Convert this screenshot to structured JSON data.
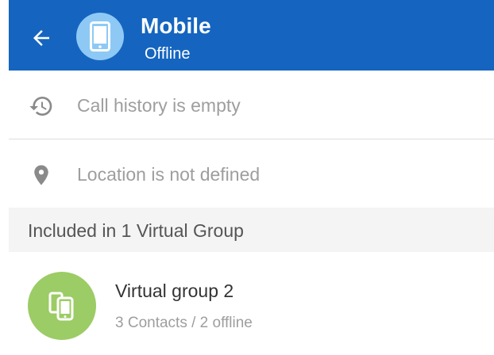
{
  "header": {
    "title": "Mobile",
    "status": "Offline",
    "back_icon": "arrow-left-icon",
    "avatar_icon": "mobile-phone-icon"
  },
  "call_history": {
    "icon": "history-icon",
    "text": "Call history is empty"
  },
  "location": {
    "icon": "location-pin-icon",
    "text": "Location is not defined"
  },
  "virtual_groups": {
    "section_title": "Included in 1 Virtual Group",
    "items": [
      {
        "icon": "multiple-devices-icon",
        "name": "Virtual group 2",
        "meta": "3 Contacts / 2 offline"
      }
    ]
  },
  "colors": {
    "header_bg": "#1565c0",
    "avatar_bg": "#8ec9f5",
    "group_avatar_bg": "#9ccc65",
    "muted_text": "#9e9e9e",
    "icon_gray": "#8a8a8a"
  }
}
